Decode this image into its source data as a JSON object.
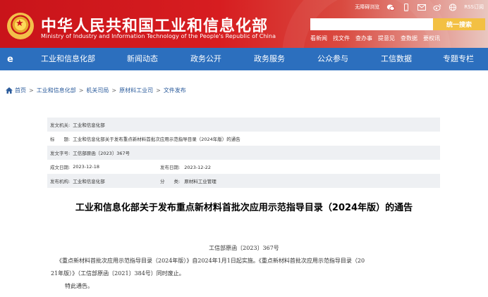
{
  "header": {
    "title": "中华人民共和国工业和信息化部",
    "subtitle": "Ministry of Industry and Information Technology of the People's Republic of China",
    "top_links": {
      "accessibility": "无障碍浏览",
      "rss": "RSS订阅"
    },
    "search_placeholder": "",
    "search_button": "统一搜索",
    "quick_links": [
      "看新闻",
      "找文件",
      "查办事",
      "提意见",
      "查数据",
      "要权讯"
    ]
  },
  "nav": {
    "items": [
      "工业和信息化部",
      "新闻动态",
      "政务公开",
      "政务服务",
      "公众参与",
      "工信数据",
      "专题专栏"
    ]
  },
  "breadcrumb": [
    "首页",
    "工业和信息化部",
    "机关司局",
    "原材料工业司",
    "文件发布"
  ],
  "info": {
    "issuer_label": "发文机关:",
    "issuer": "工业和信息化部",
    "title_label": "标　　题:",
    "title": "工业和信息化部关于发布重点新材料首批次应用示范指导目录（2024年版）的通告",
    "doc_no_label": "发文字号:",
    "doc_no": "工信部原函〔2023〕367号",
    "created_label": "成文日期:",
    "created": "2023-12-18",
    "published_label": "发布日期:",
    "published": "2023-12-22",
    "org_label": "发布机构:",
    "org": "工业和信息化部",
    "category_label": "分　　类:",
    "category": "原材料工业管理"
  },
  "article": {
    "title": "工业和信息化部关于发布重点新材料首批次应用示范指导目录（2024年版）的通告",
    "doc_no": "工信部原函〔2023〕367号",
    "para1_line1": "《重点新材料首批次应用示范指导目录（2024年版）》自2024年1月1日起实施。《重点新材料首批次应用示范指导目录（20",
    "para1_line2": "21年版）》（工信部原函〔2021〕384号）同时废止。",
    "para2": "特此通告。"
  }
}
